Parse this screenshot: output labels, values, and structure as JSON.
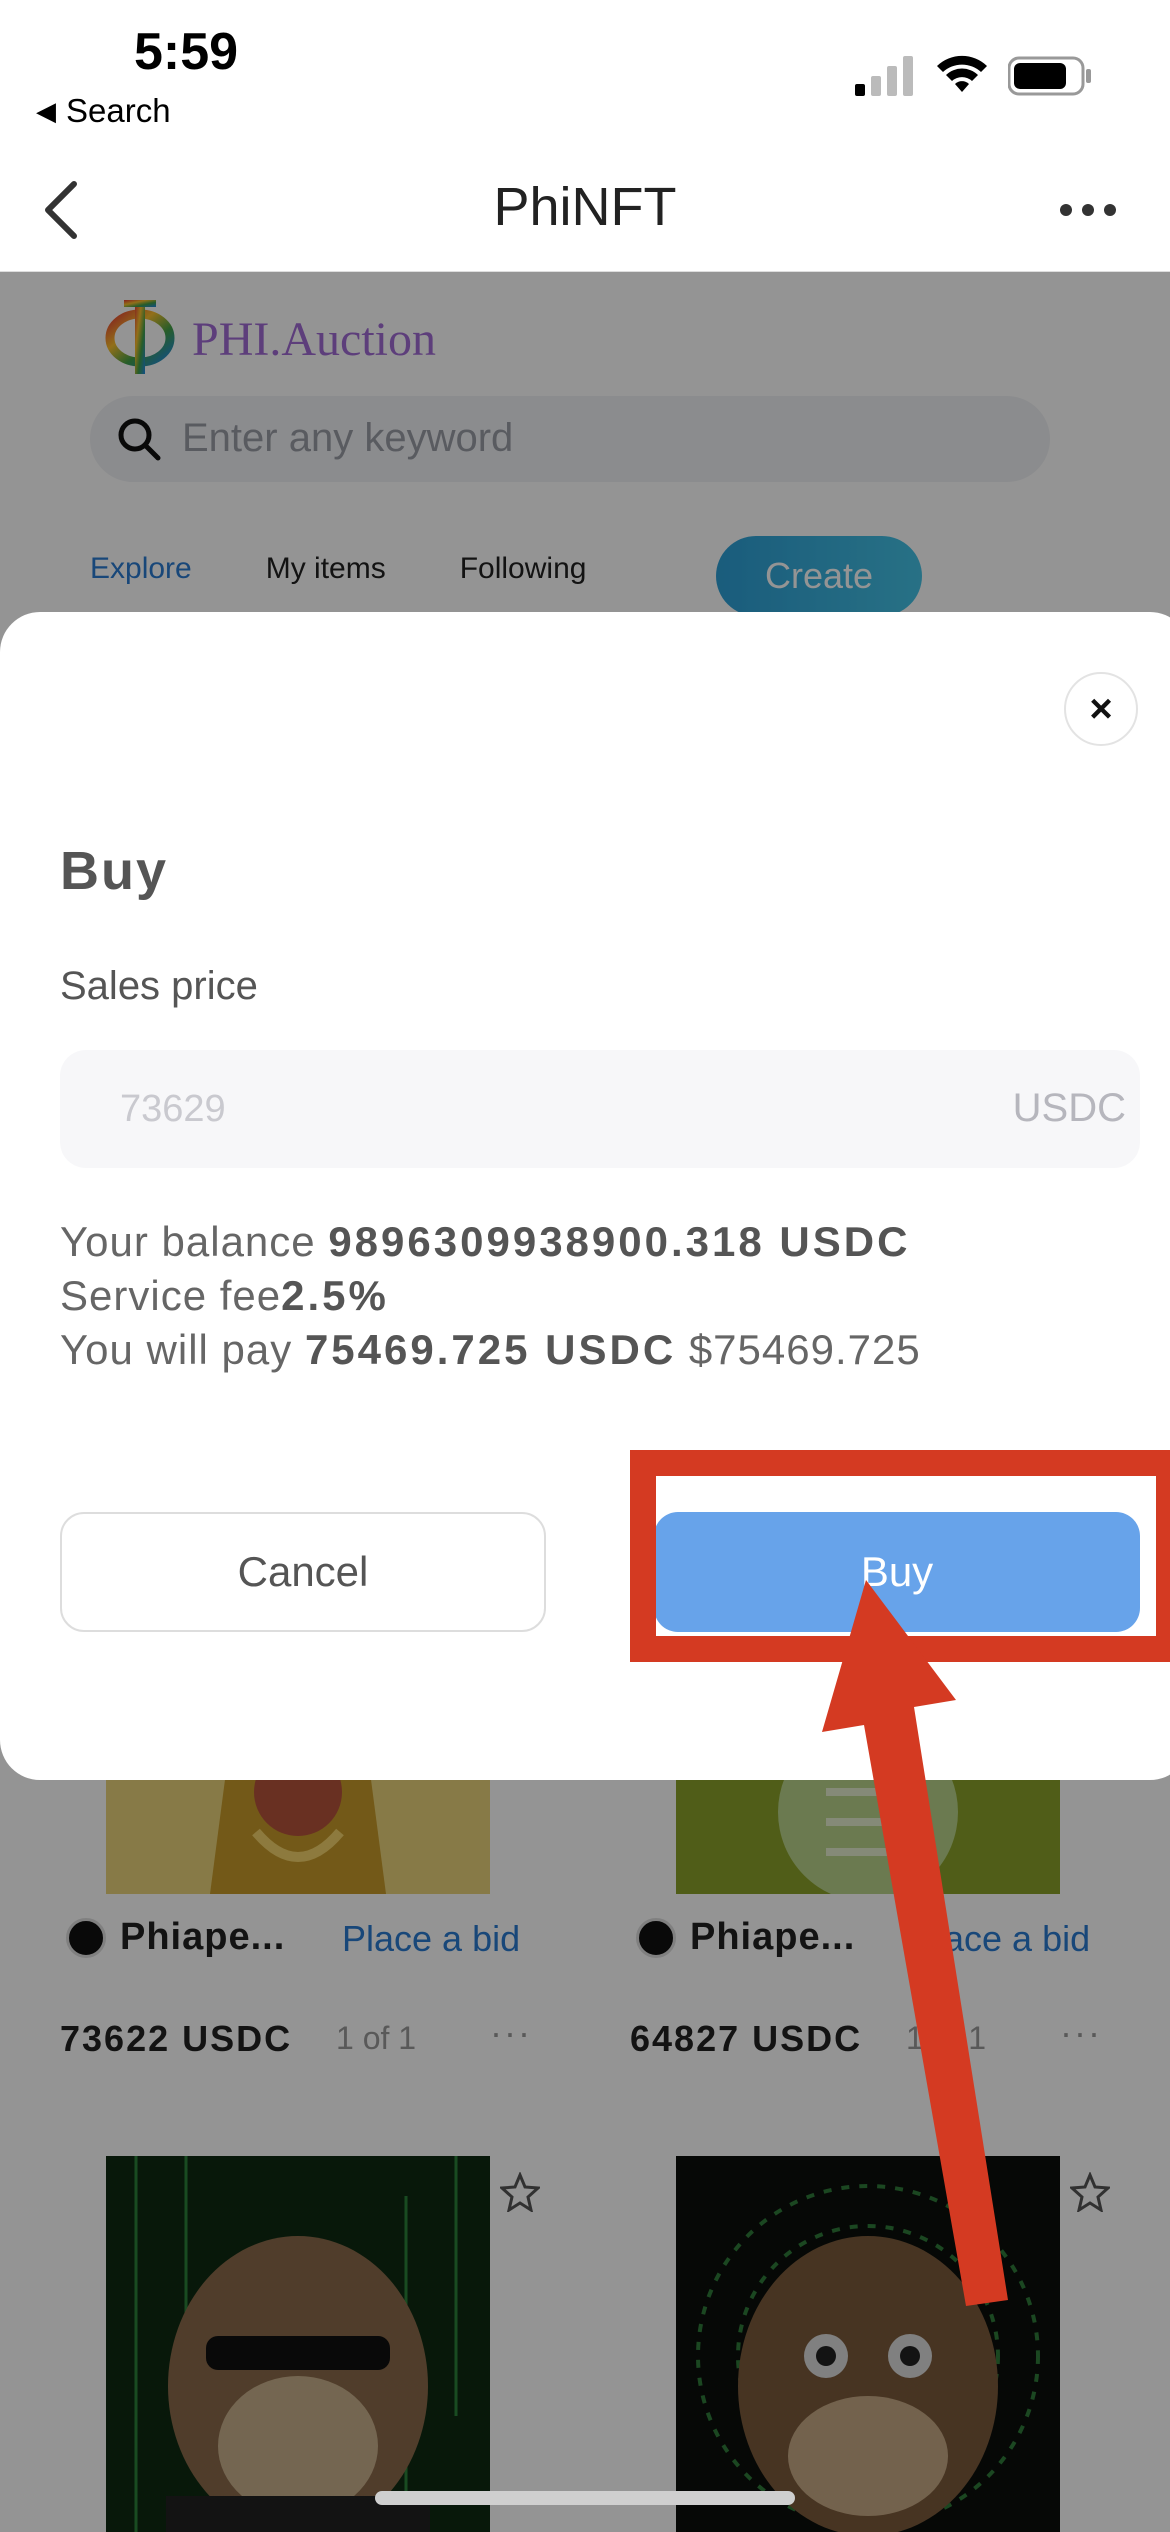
{
  "status_bar": {
    "time": "5:59",
    "back_app_label": "Search",
    "icons": [
      "signal-icon",
      "wifi-icon",
      "battery-icon"
    ]
  },
  "nav": {
    "title": "PhiNFT",
    "icons": [
      "chevron-left-icon",
      "more-horizontal-icon"
    ]
  },
  "site": {
    "logo_text": "PHI.Auction",
    "search_placeholder": "Enter any keyword",
    "tabs": [
      {
        "label": "Explore",
        "active": true
      },
      {
        "label": "My items",
        "active": false
      },
      {
        "label": "Following",
        "active": false
      }
    ],
    "create_label": "Create",
    "cards": [
      {
        "owner": "Phiape...",
        "action": "Place a bid",
        "price": "73622 USDC",
        "edition": "1 of 1",
        "more": "···"
      },
      {
        "owner": "Phiape...",
        "action": "Place a bid",
        "price": "64827 USDC",
        "edition": "1 of 1",
        "more": "···"
      }
    ]
  },
  "modal": {
    "close_label": "×",
    "title": "Buy",
    "sales_price_label": "Sales price",
    "price_value": "73629",
    "price_unit": "USDC",
    "balance_prefix": "Your balance ",
    "balance_value": "9896309938900.318 USDC",
    "fee_prefix": "Service fee",
    "fee_value": "2.5%",
    "pay_prefix": "You will pay ",
    "pay_value": "75469.725 USDC",
    "pay_fiat": " $75469.725",
    "cancel_label": "Cancel",
    "buy_label": "Buy"
  },
  "colors": {
    "accent_blue": "#2a7ad1",
    "buy_button": "#67a3ea",
    "annotation_red": "#d43a22"
  }
}
